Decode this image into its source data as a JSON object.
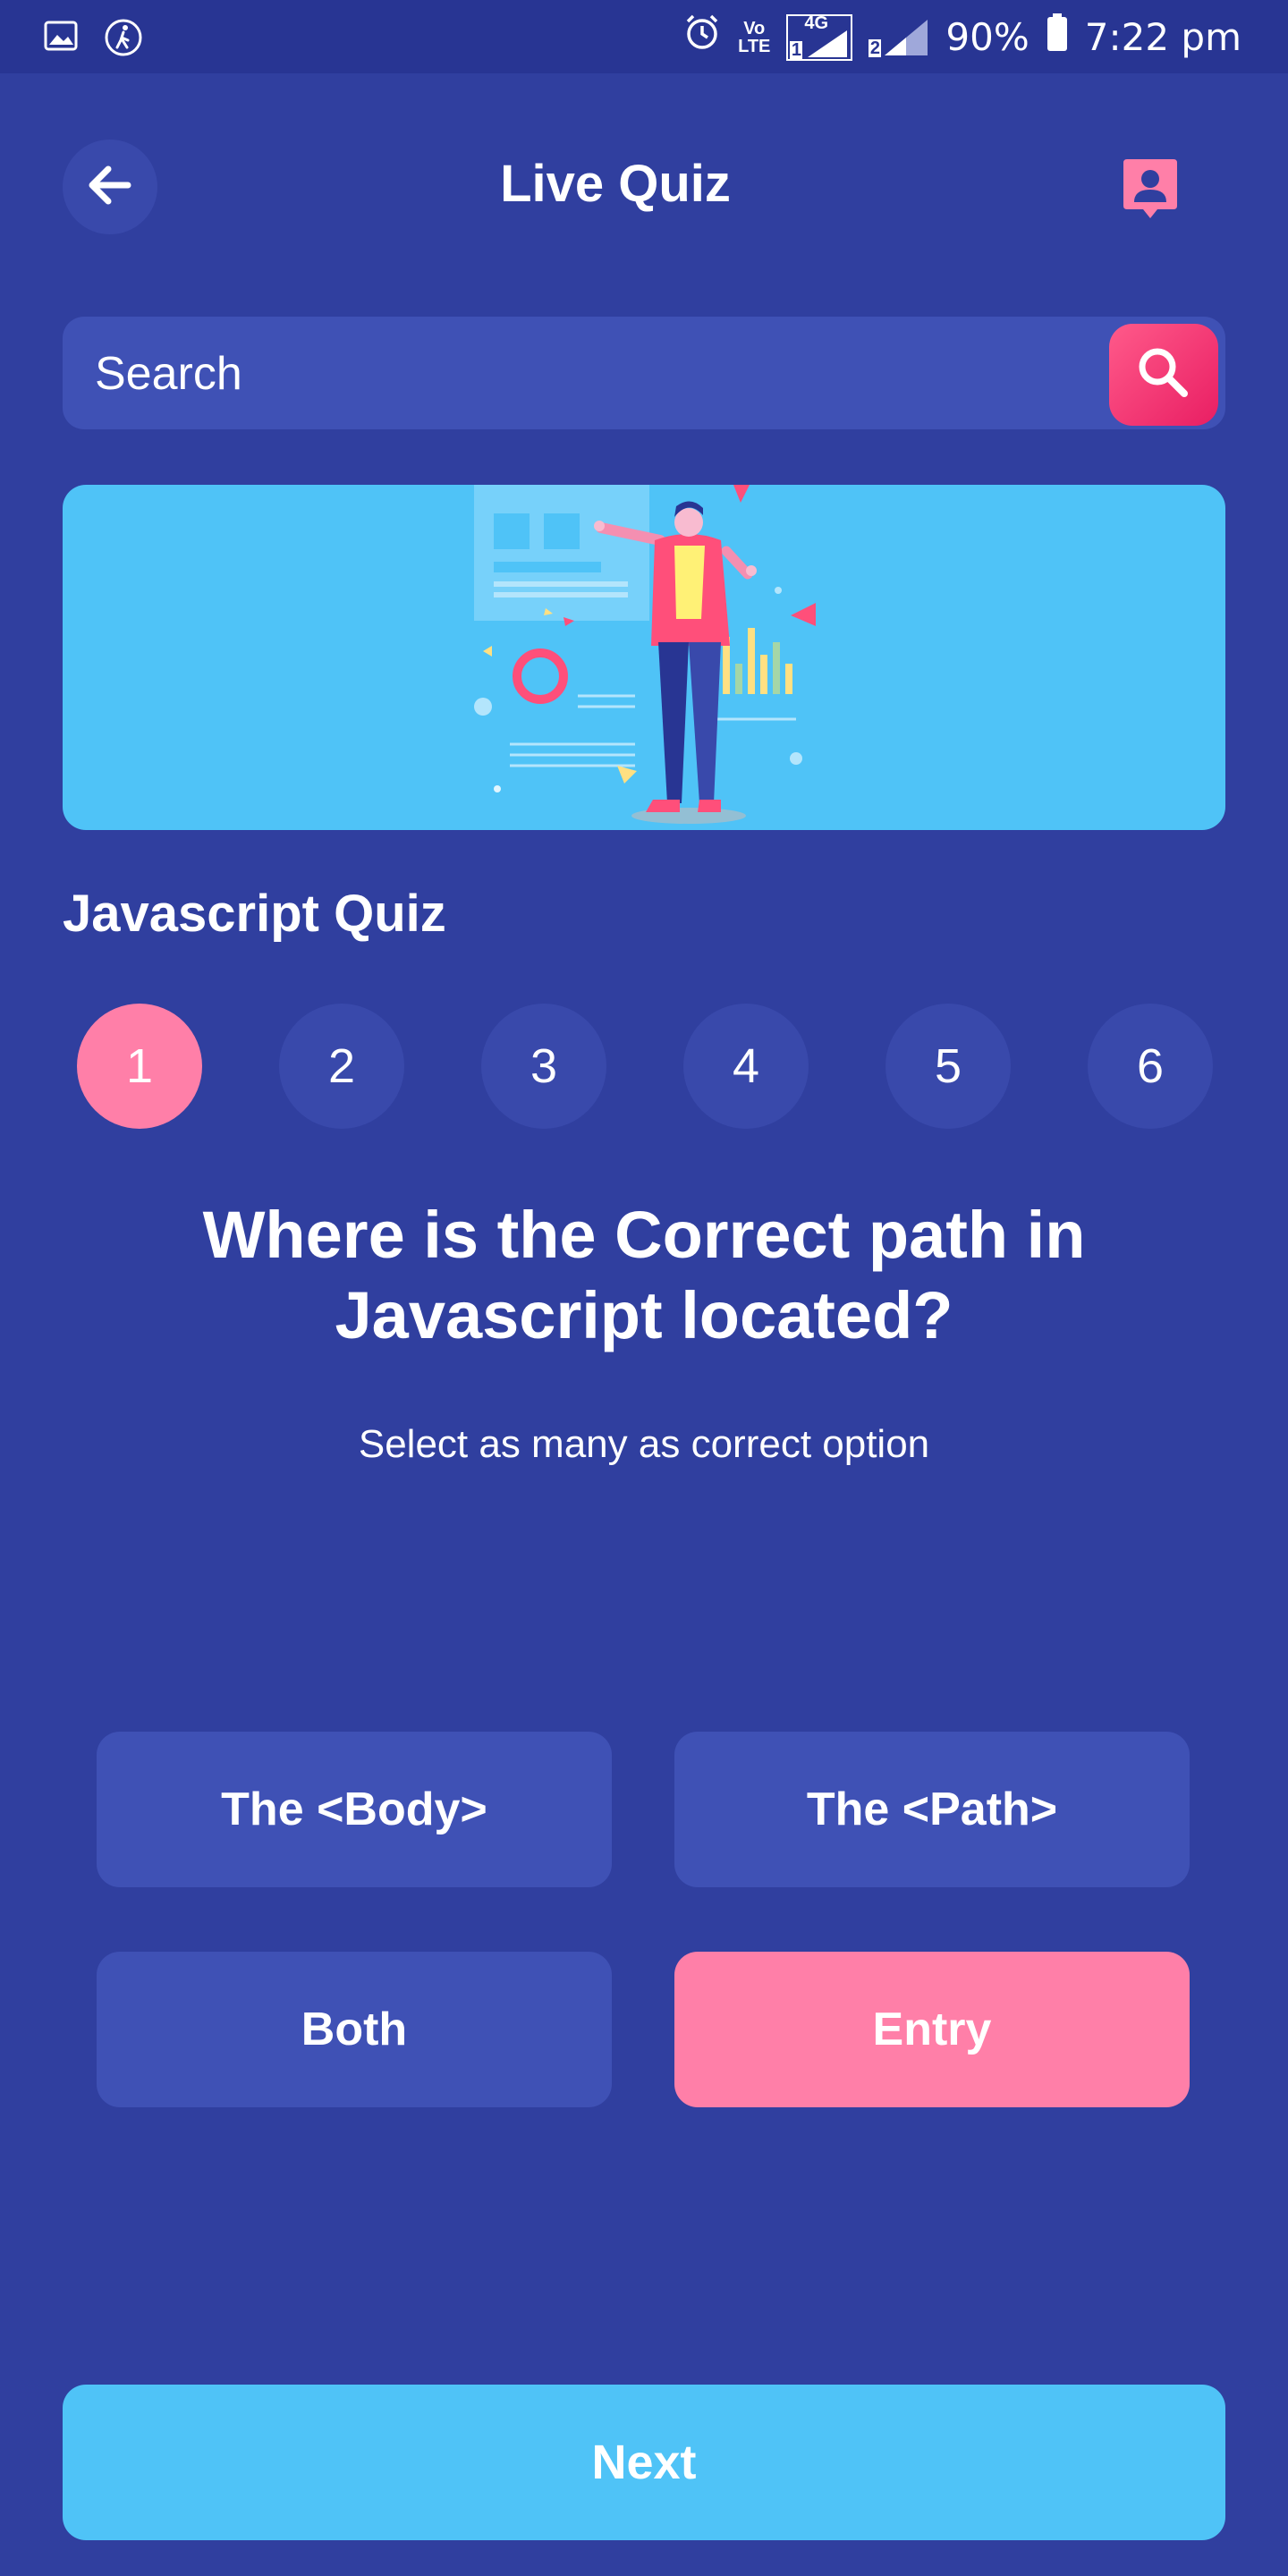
{
  "status_bar": {
    "left_icons": [
      "gallery-icon",
      "walking-icon"
    ],
    "right_icons": [
      "alarm-icon",
      "volte-icon",
      "sim1-4g-signal-icon",
      "sim2-signal-icon",
      "battery-icon"
    ],
    "volte_top": "Vo",
    "volte_bottom": "LTE",
    "network": "4G",
    "sim1": "1",
    "sim2": "2",
    "battery_percent": "90%",
    "time": "7:22 pm"
  },
  "header": {
    "title": "Live Quiz",
    "back_icon": "arrow-left-icon",
    "profile_icon": "user-badge-icon"
  },
  "search": {
    "placeholder": "Search",
    "button_icon": "search-icon"
  },
  "banner": {
    "illustration": "presenter-with-charts-illustration"
  },
  "quiz": {
    "title": "Javascript Quiz",
    "steps": [
      "1",
      "2",
      "3",
      "4",
      "5",
      "6"
    ],
    "active_step": "1",
    "question": "Where is the Correct path in Javascript located?",
    "instruction": "Select as many as correct option",
    "options": [
      "The <Body>",
      "The <Path>",
      "Both",
      "Entry"
    ],
    "selected_option": "Entry"
  },
  "footer": {
    "next_label": "Next"
  },
  "colors": {
    "background": "#303f9f",
    "status_bar": "#283593",
    "card": "#3f51b5",
    "accent_pink": "#ff7fa8",
    "accent_blue": "#4fc3f7",
    "search_button": "#e91e63"
  }
}
